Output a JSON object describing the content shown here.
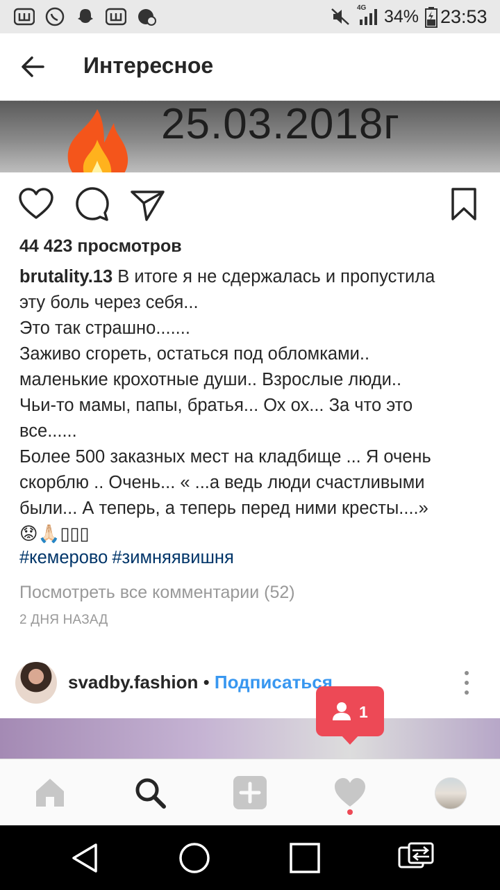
{
  "status_bar": {
    "network": "4G",
    "battery": "34%",
    "time": "23:53"
  },
  "header": {
    "title": "Интересное"
  },
  "media": {
    "date_text": "25.03.2018г"
  },
  "post": {
    "views": "44 423 просмотров",
    "username": "brutality.13",
    "caption_lines": [
      " В итоге я не сдержалась и пропустила",
      "эту боль через себя...",
      "Это так страшно.......",
      "Заживо сгореть, остаться под обломками..",
      "маленькие крохотные души.. Взрослые люди..",
      "Чьи-то мамы, папы, братья... Ох ох... За что это",
      "все......",
      "Более 500 заказных мест на кладбище ... Я очень",
      "скорблю .. Очень... « ...а ведь люди счастливыми",
      "были... А теперь, а теперь перед ними кресты....»"
    ],
    "emoji_line": "😟🙏🏻▯▯▯",
    "hashtags": [
      "#кемерово",
      "#зимняявишня"
    ],
    "view_comments": "Посмотреть все комментарии (52)",
    "time_ago": "2 ДНЯ НАЗАД"
  },
  "next_post": {
    "username": "svadby.fashion",
    "separator": " • ",
    "follow_label": "Подписаться"
  },
  "notification": {
    "count": "1",
    "icon": "person-icon"
  },
  "colors": {
    "link_blue": "#3897f0",
    "hashtag_blue": "#003569",
    "notif_red": "#ed4956",
    "muted_gray": "#999999"
  }
}
